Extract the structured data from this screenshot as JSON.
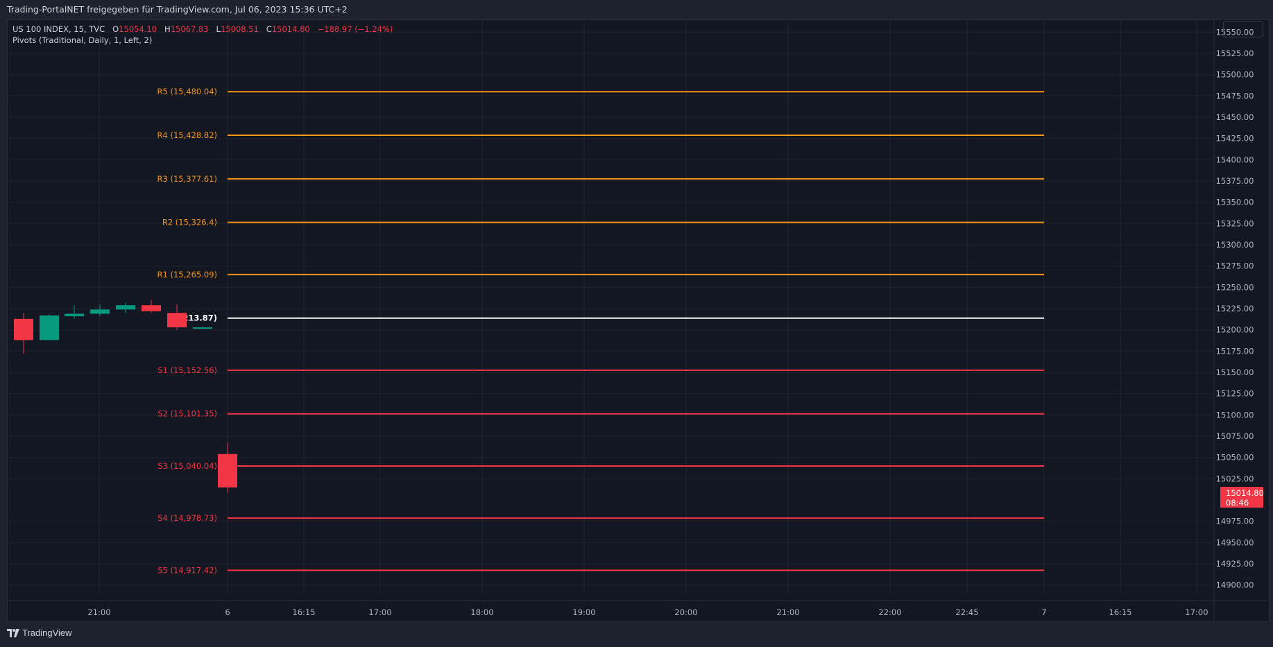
{
  "header": {
    "publisher_line": "Trading-PortalNET freigegeben für TradingView.com, Jul 06, 2023 15:36 UTC+2"
  },
  "legend": {
    "symbol": "US 100 INDEX, 15, TVC",
    "open_label": "O",
    "open_value": "15054.10",
    "high_label": "H",
    "high_value": "15067.83",
    "low_label": "L",
    "low_value": "15008.51",
    "close_label": "C",
    "close_value": "15014.80",
    "change": "−188.97 (−1.24%)",
    "indicator": "Pivots (Traditional, Daily, 1, Left, 2)"
  },
  "price_badge": {
    "price": "15014.80",
    "countdown": "08:46"
  },
  "brand": {
    "name": "TradingView"
  },
  "colors": {
    "background": "#131722",
    "grid": "#2a2e39",
    "resistance": "#f7931a",
    "support": "#f23645",
    "pivot": "#ffffff",
    "bull": "#089981",
    "bear": "#f23645",
    "axis_text": "#b2b5be"
  },
  "chart_data": {
    "type": "candlestick",
    "y_axis": {
      "min": 14890,
      "max": 15565,
      "ticks": [
        14900,
        14925,
        14950,
        14975,
        15025,
        15050,
        15075,
        15100,
        15125,
        15150,
        15175,
        15200,
        15225,
        15250,
        15275,
        15300,
        15325,
        15350,
        15375,
        15400,
        15425,
        15450,
        15475,
        15500,
        15525,
        15550
      ],
      "tick_labels": [
        "14900.00",
        "14925.00",
        "14950.00",
        "14975.00",
        "15025.00",
        "15050.00",
        "15075.00",
        "15100.00",
        "15125.00",
        "15150.00",
        "15175.00",
        "15200.00",
        "15225.00",
        "15250.00",
        "15275.00",
        "15300.00",
        "15325.00",
        "15350.00",
        "15375.00",
        "15400.00",
        "15425.00",
        "15450.00",
        "15475.00",
        "15500.00",
        "15525.00",
        "15550.00"
      ]
    },
    "x_axis": {
      "labels": [
        "21:00",
        "6",
        "16:15",
        "17:00",
        "18:00",
        "19:00",
        "20:00",
        "21:00",
        "22:00",
        "22:45",
        "7",
        "16:15",
        "17:00"
      ]
    },
    "pivot_levels": [
      {
        "name": "R5",
        "label": "R5 (15,480.04)",
        "value": 15480.04,
        "kind": "resistance"
      },
      {
        "name": "R4",
        "label": "R4 (15,428.82)",
        "value": 15428.82,
        "kind": "resistance"
      },
      {
        "name": "R3",
        "label": "R3 (15,377.61)",
        "value": 15377.61,
        "kind": "resistance"
      },
      {
        "name": "R2",
        "label": "R2 (15,326.4)",
        "value": 15326.4,
        "kind": "resistance"
      },
      {
        "name": "R1",
        "label": "R1 (15,265.09)",
        "value": 15265.09,
        "kind": "resistance"
      },
      {
        "name": "P",
        "label": "213.87)",
        "value": 15213.87,
        "kind": "pivot"
      },
      {
        "name": "S1",
        "label": "S1 (15,152.56)",
        "value": 15152.56,
        "kind": "support"
      },
      {
        "name": "S2",
        "label": "S2 (15,101.35)",
        "value": 15101.35,
        "kind": "support"
      },
      {
        "name": "S3",
        "label": "S3 (15,040.04)",
        "value": 15040.04,
        "kind": "support"
      },
      {
        "name": "S4",
        "label": "S4 (14,978.73)",
        "value": 14978.73,
        "kind": "support"
      },
      {
        "name": "S5",
        "label": "S5 (14,917.42)",
        "value": 14917.42,
        "kind": "support"
      }
    ],
    "candles": [
      {
        "open": 15213,
        "high": 15220,
        "low": 15172,
        "close": 15188
      },
      {
        "open": 15188,
        "high": 15218,
        "low": 15188,
        "close": 15217
      },
      {
        "open": 15216,
        "high": 15229,
        "low": 15213,
        "close": 15219
      },
      {
        "open": 15219,
        "high": 15230,
        "low": 15216,
        "close": 15224
      },
      {
        "open": 15224,
        "high": 15232,
        "low": 15220,
        "close": 15229
      },
      {
        "open": 15229,
        "high": 15235,
        "low": 15220,
        "close": 15222
      },
      {
        "open": 15220,
        "high": 15230,
        "low": 15200,
        "close": 15203
      },
      {
        "open": 15203,
        "high": 15204,
        "low": 15202,
        "close": 15203
      },
      {
        "open": 15054.1,
        "high": 15067.83,
        "low": 15008.51,
        "close": 15014.8
      }
    ]
  }
}
